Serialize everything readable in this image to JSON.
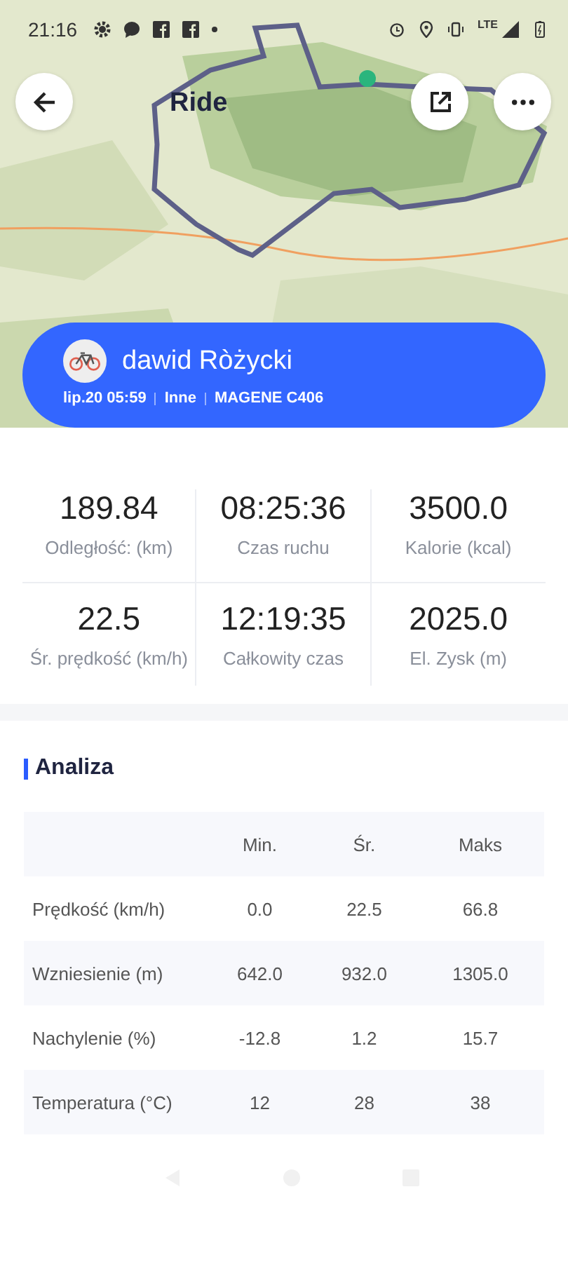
{
  "status_bar": {
    "time": "21:16",
    "network": "LTE"
  },
  "header": {
    "title": "Ride"
  },
  "activity": {
    "user_name": "dawid Ròżycki",
    "meta": [
      "lip.20 05:59",
      "Inne",
      "MAGENE C406"
    ]
  },
  "stats": [
    {
      "value": "189.84",
      "label": "Odległość: (km)"
    },
    {
      "value": "08:25:36",
      "label": "Czas ruchu"
    },
    {
      "value": "3500.0",
      "label": "Kalorie (kcal)"
    },
    {
      "value": "22.5",
      "label": "Śr. prędkość (km/h)"
    },
    {
      "value": "12:19:35",
      "label": "Całkowity czas"
    },
    {
      "value": "2025.0",
      "label": "El. Zysk (m)"
    }
  ],
  "analysis": {
    "title": "Analiza",
    "columns": [
      "Min.",
      "Śr.",
      "Maks"
    ],
    "rows": [
      {
        "label": "Prędkość (km/h)",
        "values": [
          "0.0",
          "22.5",
          "66.8"
        ]
      },
      {
        "label": "Wzniesienie (m)",
        "values": [
          "642.0",
          "932.0",
          "1305.0"
        ]
      },
      {
        "label": "Nachylenie (%)",
        "values": [
          "-12.8",
          "1.2",
          "15.7"
        ]
      },
      {
        "label": "Temperatura (°C)",
        "values": [
          "12",
          "28",
          "38"
        ]
      }
    ]
  }
}
